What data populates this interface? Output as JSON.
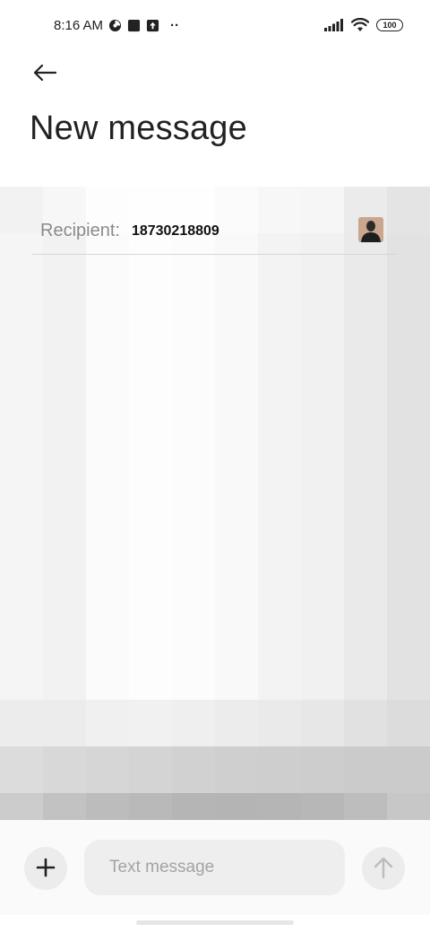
{
  "status_bar": {
    "time": "8:16 AM",
    "dots": "··",
    "battery": "100",
    "icons": [
      "data-saver-icon",
      "square-notification-icon",
      "upload-notification-icon",
      "signal-icon",
      "wifi-icon",
      "battery-icon"
    ]
  },
  "header": {
    "back_icon": "back-arrow-icon",
    "title": "New message"
  },
  "recipient": {
    "label": "Recipient:",
    "value": "18730218809",
    "avatar_icon": "contact-avatar-icon"
  },
  "compose": {
    "add_icon": "plus-icon",
    "placeholder": "Text message",
    "send_icon": "send-arrow-icon"
  },
  "colors": {
    "background": "#ffffff",
    "title_text": "#222222",
    "label_text": "#8a8a8a",
    "input_bg": "#eeeeee"
  }
}
